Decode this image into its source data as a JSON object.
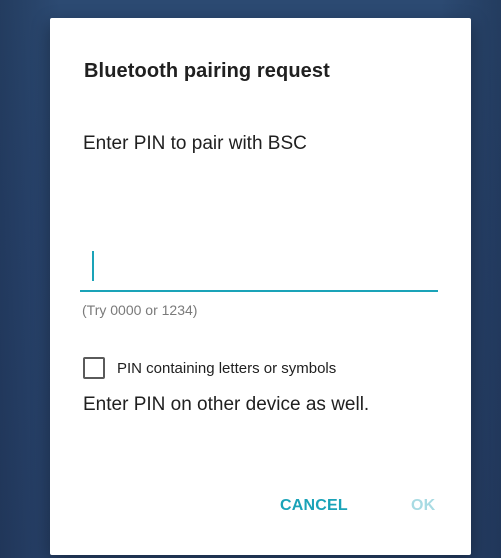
{
  "dialog": {
    "title": "Bluetooth pairing request",
    "message": "Enter PIN to pair with BSC",
    "pin_input": {
      "value": "",
      "placeholder": ""
    },
    "hint": "(Try 0000 or 1234)",
    "checkbox": {
      "label": "PIN containing letters or symbols",
      "checked": false
    },
    "other_device_message": "Enter PIN on other device as well.",
    "buttons": {
      "cancel_label": "CANCEL",
      "ok_label": "OK"
    }
  },
  "colors": {
    "accent": "#1aa3b8",
    "ok_disabled": "#a8dbe3",
    "background": "#2a4670",
    "text": "#202020",
    "hint_text": "#7a7a7a"
  }
}
